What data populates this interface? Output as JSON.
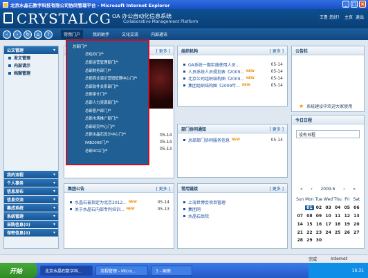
{
  "window": {
    "title": "北京水晶石数字科技有限公司协同管理平台 - Microsoft Internet Explorer"
  },
  "banner": {
    "logo": "CRYSTALCG",
    "oa_title": "OA 办公自动化信息系统",
    "oa_subtitle": "Collaborative Management Platform",
    "user_links": [
      "王鲁 您好！",
      "主页",
      "退出"
    ]
  },
  "navbar": {
    "icons": [
      "back-icon",
      "forward-icon",
      "refresh-icon",
      "home-icon",
      "help-icon"
    ],
    "menus": [
      "常用门户",
      "我的助手",
      "文化交流",
      "内部通讯"
    ]
  },
  "dropdown": {
    "items": [
      "总部门户",
      "总经办门户",
      "总部运营管理部门户",
      "总部财务部门户",
      "总部商业演示营销管理中心门户",
      "总部软件关系部门户",
      "总部审计门户",
      "总部人力资源部门户",
      "总部客户部门户",
      "总部市场推广部门户",
      "总部研究中心门户",
      "总部水晶石设计中心门户",
      "FAB2000门户",
      "总部0CG门户"
    ]
  },
  "sidebar": {
    "top_header": "公文管理",
    "top_items": [
      "发文管理",
      "内部请示",
      "档案管理"
    ],
    "bottom_headers": [
      "我的流程",
      "个人事务",
      "信息发布",
      "信息交流",
      "集成系统",
      "系统管理",
      "采购信息(0)",
      "保密信息(0)"
    ]
  },
  "portlets": {
    "more_label": "[ 更多 ]",
    "org": {
      "title": "组织机构",
      "rows": [
        {
          "text": "OA系统一期实施使用人员...",
          "date": "05-14",
          "is_new": false
        },
        {
          "text": "人员系统人员规划表《2009...",
          "date": "05-14",
          "is_new": true
        },
        {
          "text": "北京公司组织结构图《2009...",
          "date": "05-14",
          "is_new": true
        },
        {
          "text": "集团组织结构图《2009年...",
          "date": "05-14",
          "is_new": true
        }
      ]
    },
    "announce": {
      "title": "公告栏",
      "item": "系统建设中欢迎大家使用"
    },
    "hidden_left": {
      "dates": [
        "05-14",
        "05-14",
        "05-13"
      ]
    },
    "dept": {
      "title": "部门协同通知",
      "rows": [
        {
          "text": "总部部门协同服务信息",
          "date": "05-14",
          "is_new": true
        }
      ]
    },
    "schedule": {
      "title": "今日日程",
      "input_value": "设有日程"
    },
    "group": {
      "title": "集团公告",
      "rows": [
        {
          "text": "水晶石被指定为北京2012...",
          "date": "05-14",
          "is_new": true
        },
        {
          "text": "关于水晶石内部专利培训...",
          "date": "05-13",
          "is_new": true
        }
      ]
    },
    "links": {
      "title": "常用链接",
      "rows": [
        "上海世博会项目管理",
        "集团网",
        "水晶石后院"
      ]
    }
  },
  "calendar": {
    "nav": [
      "«",
      "‹",
      "2009.6",
      "›",
      "»"
    ],
    "weekdays": [
      "Sun",
      "Mon",
      "Tue",
      "Wed",
      "Thu",
      "Fri",
      "Sat"
    ],
    "weeks": [
      [
        "",
        "01",
        "02",
        "03",
        "04",
        "05",
        "06"
      ],
      [
        "07",
        "08",
        "09",
        "10",
        "11",
        "12",
        "13"
      ],
      [
        "14",
        "15",
        "16",
        "17",
        "18",
        "19",
        "20"
      ],
      [
        "21",
        "22",
        "23",
        "24",
        "25",
        "26",
        "27"
      ],
      [
        "28",
        "29",
        "30",
        "",
        "",
        "",
        ""
      ]
    ],
    "today": "01"
  },
  "status_bar": {
    "left": "完成",
    "right": "Internet"
  },
  "taskbar": {
    "start": "开始",
    "tasks": [
      "北京水晶石数字科...",
      "流程管理 - Micro...",
      "3 - 画图"
    ],
    "time": "16:31"
  },
  "colors": {
    "accent": "#1c5fa0",
    "highlight": "#c8102e",
    "new_badge": "#f08a00"
  }
}
